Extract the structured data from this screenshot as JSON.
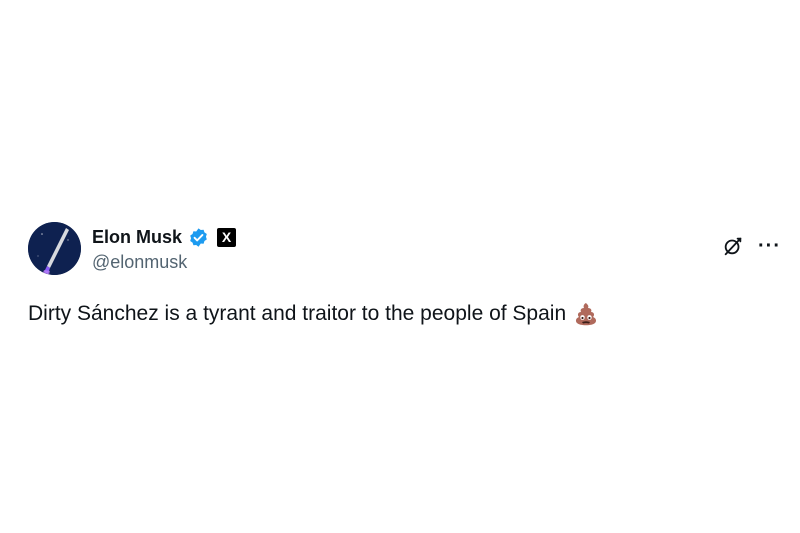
{
  "tweet": {
    "author": {
      "display_name": "Elon Musk",
      "handle": "@elonmusk",
      "verified_icon": "verified-badge-icon",
      "affiliate_badge": "X",
      "avatar_icon": "avatar-rocket-image"
    },
    "text": "Dirty Sánchez is a tyrant and traitor to the people of Spain",
    "emoji_icon": "pile-of-poo-icon",
    "actions": {
      "grok_icon": "grok-icon",
      "more_icon": "more-options-icon",
      "more_glyph": "···"
    }
  },
  "colors": {
    "text_primary": "#0f1419",
    "text_secondary": "#536471",
    "verified_blue": "#1d9bf0",
    "background": "#ffffff"
  }
}
